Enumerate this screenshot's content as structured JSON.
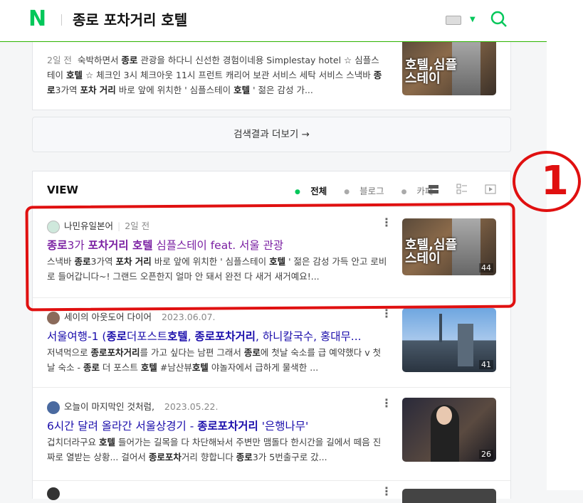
{
  "header": {
    "logo": "N",
    "query": "종로 포차거리 호텔"
  },
  "top_card": {
    "date": "2일 전",
    "snippet_html": "숙박하면서 <b>종로</b> 관광을 하다니 신선한 경험이네용 Simplestay hotel ☆ 심플스테이 <b>호텔</b> ☆ 체크인 3시 체크아웃 11시 프런트 캐리어 보관 서비스 세탁 서비스 스낵바 <b>종로</b>3가역 <b>포차 거리</b> 바로 앞에 위치한 ' 심플스테이 <b>호텔</b> ' 젊은 감성 가...",
    "thumb_text": "호텔,심플\n스테이"
  },
  "more_button": "검색결과 더보기 →",
  "view": {
    "header": "VIEW",
    "filters": [
      "전체",
      "블로그",
      "카페"
    ],
    "items": [
      {
        "author": "나민유일본어",
        "date": "2일 전",
        "title_html": "<b>종로</b>3가 <b>포차거리 호텔</b> 심플스테이 feat. 서울 관광",
        "snippet_html": "스낵바 <b>종로</b>3가역 <b>포차 거리</b> 바로 앞에 위치한 ' 심플스테이 <b>호텔</b> ' 젊은 감성 가득 안고 로비로 들어갑니다~! 그랜드 오픈한지 얼마 안 돼서 완전 다 새거 새거예요!...",
        "thumb_text": "호텔,심플\n스테이",
        "count": "44"
      },
      {
        "author": "세이의 아웃도어 다이어",
        "date": "2023.06.07.",
        "title_html": "서울여행-1 (<b>종로</b>더포스트<b>호텔</b>, <b>종로포차거리</b>, 하니칼국수, 홍대무...",
        "snippet_html": "저녁먹으로 <b>종로포차거리</b>를 가고 싶다는 남편 그래서 <b>종로</b>에 첫날 숙소를 급 예약했다 v 첫날 숙소 - <b>종로</b> 더 포스트 <b>호텔</b> #남산뷰<b>호텔</b> 야놀자에서 급하게 물색한 ...",
        "thumb_text": "",
        "count": "41"
      },
      {
        "author": "오늘이 마지막인 것처럼,",
        "date": "2023.05.22.",
        "title_html": "6시간 달려 올라간 서울상경기 - <b>종로포차거리</b> '은행나무'",
        "snippet_html": "겁치더라구요 <b>호텔</b> 들어가는 길목을 다 차단해놔서 주변만 맴돌다 한시간을 길에서 떼음 진짜로 열받는 상황... 걸어서 <b>종로포차</b>거리 향합니다 <b>종로</b>3가 5번출구로 갔...",
        "thumb_text": "",
        "count": "26"
      }
    ]
  },
  "annotation": {
    "mark": "1"
  }
}
